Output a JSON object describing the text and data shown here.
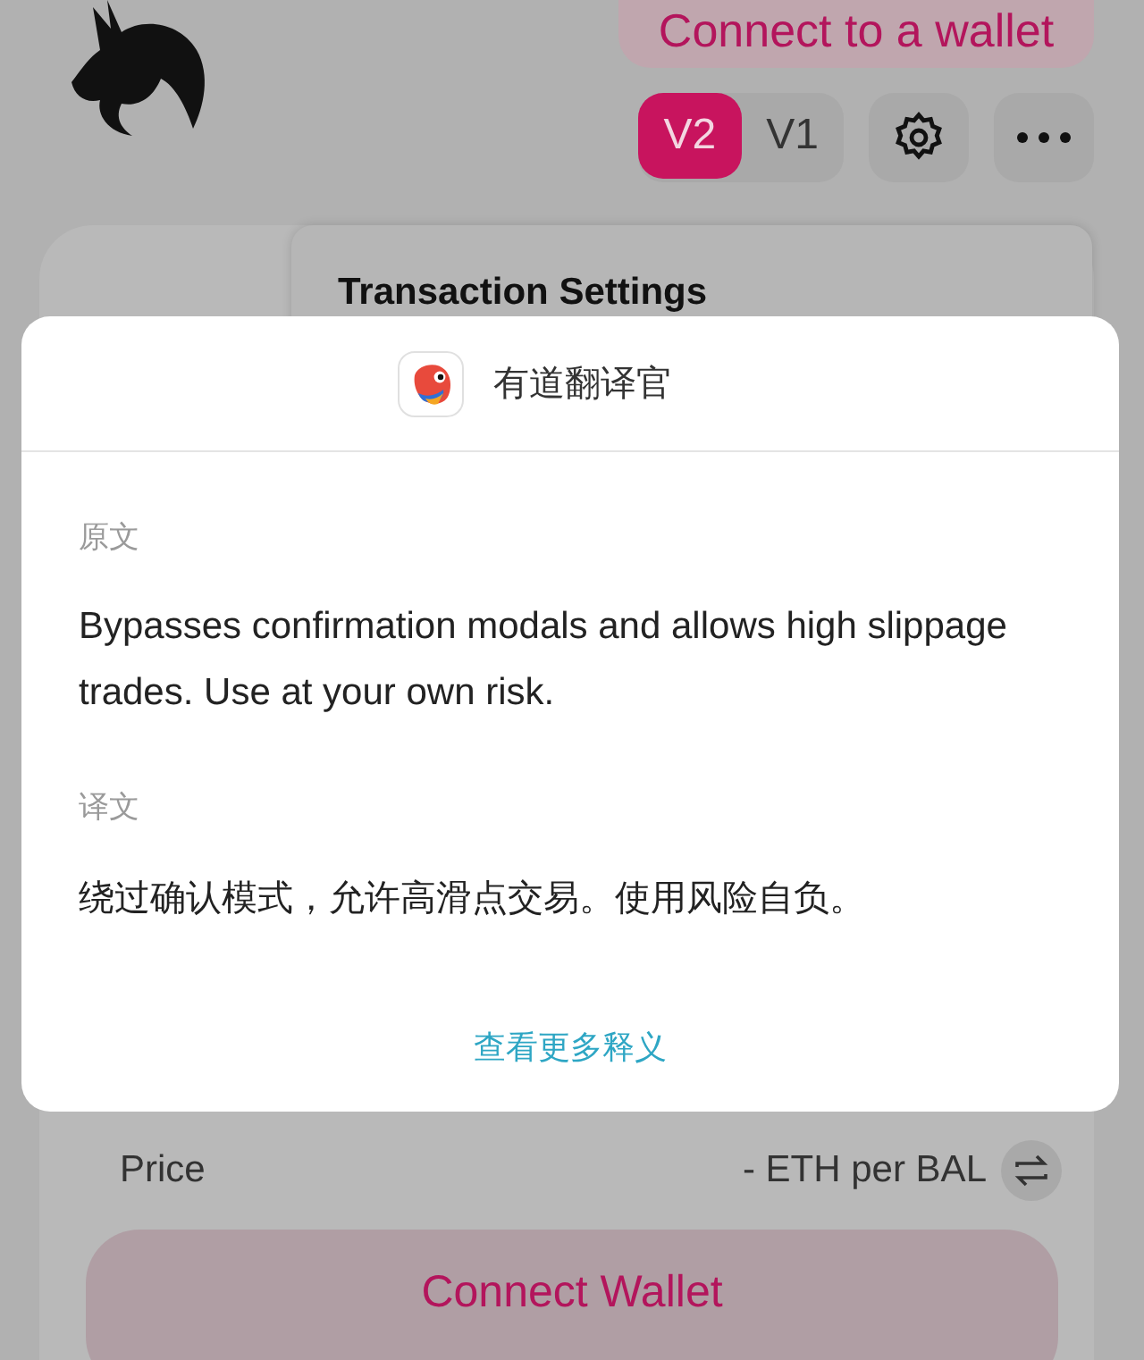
{
  "header": {
    "connect_button": "Connect to a wallet",
    "versions": [
      {
        "label": "V2",
        "selected": true
      },
      {
        "label": "V1",
        "selected": false
      }
    ]
  },
  "settings_popover": {
    "title": "Transaction Settings"
  },
  "translation_popup": {
    "app_name": "有道翻译官",
    "source_label": "原文",
    "source_text": "Bypasses confirmation modals and allows high slippage trades. Use at your own risk.",
    "translation_label": "译文",
    "translation_text": "绕过确认模式，允许高滑点交易。使用风险自负。",
    "more_link": "查看更多释义"
  },
  "swap": {
    "price_label": "Price",
    "price_value": "- ETH per BAL",
    "connect_button": "Connect Wallet"
  }
}
